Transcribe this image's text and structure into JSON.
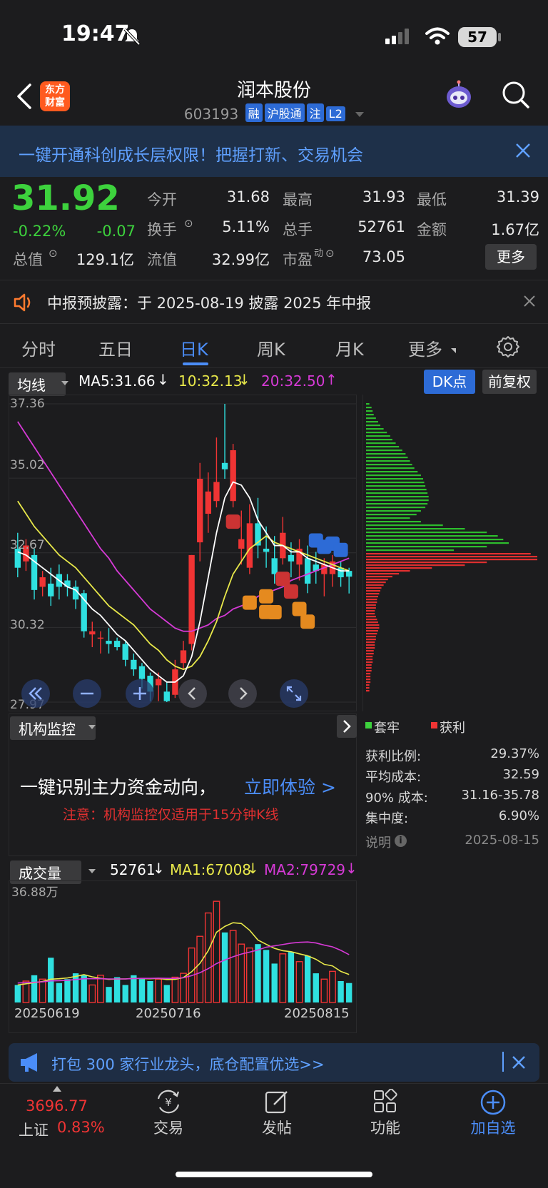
{
  "status_bar": {
    "time": "19:47",
    "battery": "57"
  },
  "nav": {
    "logo_line1": "东方",
    "logo_line2": "财富",
    "title": "润本股份",
    "code": "603193",
    "tags": [
      "融",
      "沪股通",
      "注",
      "L2"
    ]
  },
  "banner": {
    "text": "一键开通科创成长层权限！把握打新、交易机会"
  },
  "quote": {
    "price": "31.92",
    "change_pct": "-0.22%",
    "change": "-0.07",
    "fields": [
      {
        "label": "今开",
        "value": "31.68",
        "color": "#3dd23d"
      },
      {
        "label": "最高",
        "value": "31.93",
        "color": "#3dd23d"
      },
      {
        "label": "最低",
        "value": "31.39",
        "color": "#3dd23d"
      },
      {
        "label": "换手",
        "value": "5.11%",
        "color": "#e8e8e8"
      },
      {
        "label": "总手",
        "value": "52761",
        "color": "#e8e8e8"
      },
      {
        "label": "金额",
        "value": "1.67亿",
        "color": "#e8e8e8"
      },
      {
        "label": "总值",
        "value": "129.1亿",
        "color": "#e8e8e8"
      },
      {
        "label": "流值",
        "value": "32.99亿",
        "color": "#e8e8e8"
      },
      {
        "label": "市盈",
        "value": "73.05",
        "color": "#e8e8e8"
      }
    ],
    "pe_sup": "动",
    "more": "更多"
  },
  "notice": {
    "text": "中报预披露：于 2025-08-19 披露 2025 年中报"
  },
  "tabs": [
    "分时",
    "五日",
    "日K",
    "周K",
    "月K",
    "更多"
  ],
  "active_tab": 2,
  "ma_row": {
    "selector": "均线",
    "ma5": "MA5:31.66",
    "ma10": "10:32.13",
    "ma20": "20:32.50",
    "dk": "DK点",
    "adjust": "前复权"
  },
  "kline": {
    "y_labels": [
      "37.36",
      "35.02",
      "32.67",
      "30.32",
      "27.97"
    ]
  },
  "chart_data": {
    "type": "candlestick",
    "ylim": [
      27.97,
      37.36
    ],
    "y_ticks": [
      37.36,
      35.02,
      32.67,
      30.32,
      27.97
    ],
    "candles": [
      {
        "o": 32.8,
        "c": 32.2,
        "h": 33.3,
        "l": 31.9
      },
      {
        "o": 32.4,
        "c": 32.9,
        "h": 33.1,
        "l": 32.1
      },
      {
        "o": 32.6,
        "c": 31.5,
        "h": 32.8,
        "l": 31.2
      },
      {
        "o": 31.6,
        "c": 31.9,
        "h": 32.1,
        "l": 31.3
      },
      {
        "o": 31.7,
        "c": 31.3,
        "h": 32.2,
        "l": 31.0
      },
      {
        "o": 32.0,
        "c": 31.6,
        "h": 32.3,
        "l": 31.2
      },
      {
        "o": 31.8,
        "c": 31.6,
        "h": 32.0,
        "l": 31.3
      },
      {
        "o": 31.6,
        "c": 31.2,
        "h": 31.8,
        "l": 30.9
      },
      {
        "o": 31.4,
        "c": 30.2,
        "h": 31.5,
        "l": 30.0
      },
      {
        "o": 30.1,
        "c": 30.2,
        "h": 30.5,
        "l": 29.7
      },
      {
        "o": 30.0,
        "c": 30.0,
        "h": 30.2,
        "l": 29.5
      },
      {
        "o": 29.9,
        "c": 29.8,
        "h": 30.3,
        "l": 29.5
      },
      {
        "o": 29.9,
        "c": 29.7,
        "h": 30.0,
        "l": 29.6
      },
      {
        "o": 29.8,
        "c": 29.3,
        "h": 29.9,
        "l": 29.1
      },
      {
        "o": 29.3,
        "c": 29.0,
        "h": 29.5,
        "l": 28.8
      },
      {
        "o": 29.1,
        "c": 28.7,
        "h": 29.2,
        "l": 28.4
      },
      {
        "o": 28.8,
        "c": 28.3,
        "h": 28.9,
        "l": 28.0
      },
      {
        "o": 28.5,
        "c": 28.7,
        "h": 28.9,
        "l": 28.0
      },
      {
        "o": 28.3,
        "c": 28.0,
        "h": 28.6,
        "l": 27.97
      },
      {
        "o": 28.2,
        "c": 29.0,
        "h": 29.3,
        "l": 28.1
      },
      {
        "o": 29.2,
        "c": 29.6,
        "h": 29.9,
        "l": 29.0
      },
      {
        "o": 29.8,
        "c": 32.6,
        "h": 32.6,
        "l": 29.6
      },
      {
        "o": 33.0,
        "c": 35.0,
        "h": 35.5,
        "l": 32.4
      },
      {
        "o": 33.9,
        "c": 34.6,
        "h": 35.2,
        "l": 33.3
      },
      {
        "o": 34.3,
        "c": 34.9,
        "h": 36.3,
        "l": 34.1
      },
      {
        "o": 35.5,
        "c": 35.3,
        "h": 37.36,
        "l": 35.0
      },
      {
        "o": 34.3,
        "c": 35.9,
        "h": 36.1,
        "l": 34.1
      },
      {
        "o": 32.8,
        "c": 33.1,
        "h": 34.0,
        "l": 32.3
      },
      {
        "o": 32.2,
        "c": 33.6,
        "h": 34.2,
        "l": 32.0
      },
      {
        "o": 33.6,
        "c": 32.9,
        "h": 34.4,
        "l": 32.5
      },
      {
        "o": 32.8,
        "c": 32.7,
        "h": 33.5,
        "l": 32.2
      },
      {
        "o": 32.5,
        "c": 32.0,
        "h": 33.2,
        "l": 31.7
      },
      {
        "o": 32.5,
        "c": 33.3,
        "h": 33.8,
        "l": 32.3
      },
      {
        "o": 32.6,
        "c": 32.4,
        "h": 33.0,
        "l": 31.9
      },
      {
        "o": 32.3,
        "c": 32.8,
        "h": 33.1,
        "l": 31.8
      },
      {
        "o": 32.5,
        "c": 31.7,
        "h": 32.9,
        "l": 31.4
      },
      {
        "o": 32.3,
        "c": 32.1,
        "h": 32.7,
        "l": 31.7
      },
      {
        "o": 32.0,
        "c": 32.3,
        "h": 32.5,
        "l": 31.3
      },
      {
        "o": 32.0,
        "c": 32.4,
        "h": 32.6,
        "l": 31.6
      },
      {
        "o": 32.2,
        "c": 31.9,
        "h": 32.4,
        "l": 31.6
      },
      {
        "o": 32.1,
        "c": 31.92,
        "h": 32.2,
        "l": 31.39
      }
    ],
    "ma5": [
      32.7,
      32.6,
      32.4,
      32.2,
      32.0,
      31.8,
      31.6,
      31.5,
      31.2,
      30.9,
      30.7,
      30.4,
      30.1,
      29.9,
      29.6,
      29.3,
      29.0,
      28.8,
      28.6,
      28.6,
      28.8,
      29.4,
      30.5,
      31.9,
      33.3,
      34.4,
      34.9,
      34.8,
      34.4,
      33.7,
      33.3,
      32.9,
      32.9,
      32.7,
      32.7,
      32.5,
      32.4,
      32.3,
      32.2,
      32.1,
      32.1
    ],
    "ma10": [
      34.3,
      33.9,
      33.5,
      33.2,
      32.9,
      32.6,
      32.4,
      32.2,
      31.9,
      31.6,
      31.3,
      31.0,
      30.8,
      30.6,
      30.4,
      30.1,
      29.8,
      29.6,
      29.3,
      29.1,
      29.0,
      29.1,
      29.4,
      29.9,
      30.5,
      31.3,
      32.0,
      32.4,
      32.8,
      33.0,
      33.2,
      33.0,
      32.9,
      32.8,
      32.7,
      32.6,
      32.5,
      32.4,
      32.3,
      32.2,
      32.1
    ],
    "ma20": [
      36.8,
      36.4,
      36.0,
      35.6,
      35.2,
      34.8,
      34.4,
      34.0,
      33.6,
      33.2,
      32.8,
      32.5,
      32.1,
      31.8,
      31.5,
      31.2,
      30.9,
      30.7,
      30.5,
      30.3,
      30.2,
      30.2,
      30.3,
      30.4,
      30.6,
      30.7,
      30.9,
      31.0,
      31.1,
      31.3,
      31.4,
      31.5,
      31.6,
      31.8,
      31.9,
      32.0,
      32.1,
      32.2,
      32.3,
      32.4,
      32.5
    ],
    "signals": [
      {
        "i": 26,
        "type": "B"
      },
      {
        "i": 28,
        "type": "T"
      },
      {
        "i": 30,
        "type": "T"
      },
      {
        "i": 32,
        "type": "B"
      },
      {
        "i": 30,
        "type": "T"
      },
      {
        "i": 31,
        "type": "T"
      },
      {
        "i": 33,
        "type": "B"
      },
      {
        "i": 34,
        "type": "T"
      },
      {
        "i": 35,
        "type": "T"
      },
      {
        "i": 36,
        "type": "S"
      },
      {
        "i": 37,
        "type": "S"
      },
      {
        "i": 38,
        "type": "S"
      },
      {
        "i": 39,
        "type": "S"
      }
    ],
    "volume": [
      9,
      11,
      14,
      12,
      23,
      10,
      12,
      15,
      14,
      9,
      14,
      8,
      13,
      9,
      14,
      12,
      11,
      12,
      9,
      13,
      15,
      28,
      34,
      46,
      52,
      36,
      37,
      30,
      28,
      30,
      27,
      20,
      25,
      26,
      21,
      24,
      15,
      12,
      16,
      11,
      10
    ],
    "vol_ma1": [
      9,
      9.6,
      10.2,
      10.8,
      12,
      12.2,
      12.6,
      13.4,
      14.3,
      13.2,
      12.4,
      11.9,
      12.1,
      12.1,
      12.4,
      12.3,
      12.2,
      12.4,
      11.8,
      11.9,
      12.8,
      15.8,
      20.1,
      26.6,
      36.1,
      39.1,
      41,
      40.6,
      37.1,
      32.1,
      29.9,
      27.8,
      26.6,
      26.1,
      25,
      24,
      22.2,
      19.6,
      18.8,
      16,
      14.4
    ],
    "vol_ma2": [
      10,
      10.2,
      10.4,
      10.6,
      11.1,
      11.2,
      11.4,
      11.8,
      12.2,
      12.2,
      12.2,
      12.1,
      12.1,
      12.1,
      12.3,
      12.4,
      12.4,
      12.5,
      12.4,
      12.4,
      12.7,
      13.8,
      15.3,
      17.4,
      20,
      21.8,
      23.5,
      24.9,
      25.9,
      27,
      28.4,
      29.1,
      29.8,
      30.5,
      30.9,
      31.1,
      30.6,
      29.5,
      28.6,
      26.8,
      24.6
    ],
    "vol_ylabel": "36.88万",
    "dates": [
      "20250619",
      "20250716",
      "20250815"
    ],
    "profile_green": [
      3,
      5,
      6,
      7,
      9,
      11,
      13,
      16,
      19,
      22,
      24,
      27,
      30,
      33,
      36,
      38,
      40,
      42,
      44,
      47,
      50,
      52,
      53,
      54,
      55,
      56,
      57,
      57,
      56,
      54,
      50,
      46,
      40,
      50,
      70,
      90,
      110,
      120,
      125,
      130,
      110,
      80
    ],
    "profile_red": [
      150,
      170,
      160,
      110,
      90,
      60,
      40,
      30,
      24,
      20,
      18,
      16,
      14,
      13,
      12,
      11,
      10,
      10,
      9,
      9,
      8,
      8,
      9,
      10,
      11,
      12,
      12,
      11,
      10,
      9,
      9,
      8,
      8,
      8,
      7,
      7,
      6,
      6,
      6,
      5,
      5,
      5,
      4,
      4,
      4,
      4,
      3,
      3,
      3
    ]
  },
  "inst_monitor": {
    "selector": "机构监控",
    "main_text": "一键识别主力资金动向，",
    "link": "立即体验 >",
    "note": "注意：机构监控仅适用于15分钟K线"
  },
  "side_panel": {
    "legend_green": "套牢",
    "legend_red": "获利",
    "rows": [
      {
        "label": "获利比例:",
        "value": "29.37%"
      },
      {
        "label": "平均成本:",
        "value": "32.59"
      },
      {
        "label": "90% 成本:",
        "value": "31.16-35.78"
      },
      {
        "label": "集中度:",
        "value": "6.90%"
      }
    ],
    "note_label": "说明",
    "date": "2025-08-15"
  },
  "volume_row": {
    "selector": "成交量",
    "vol": "52761",
    "ma1": "MA1:67008",
    "ma2": "MA2:79729"
  },
  "ad": {
    "text": "打包 300 家行业龙头，底仓配置优选>>"
  },
  "footer": {
    "index_value": "3696.77",
    "index_name": "上证",
    "index_change": "0.83%",
    "tabs": [
      "交易",
      "发帖",
      "功能",
      "加自选"
    ]
  },
  "colors": {
    "up": "#f03434",
    "down": "#3dd23d",
    "accent": "#4b8df8",
    "cyan": "#2fe0e0",
    "yellow": "#e8e84a",
    "magenta": "#d63ad6"
  }
}
